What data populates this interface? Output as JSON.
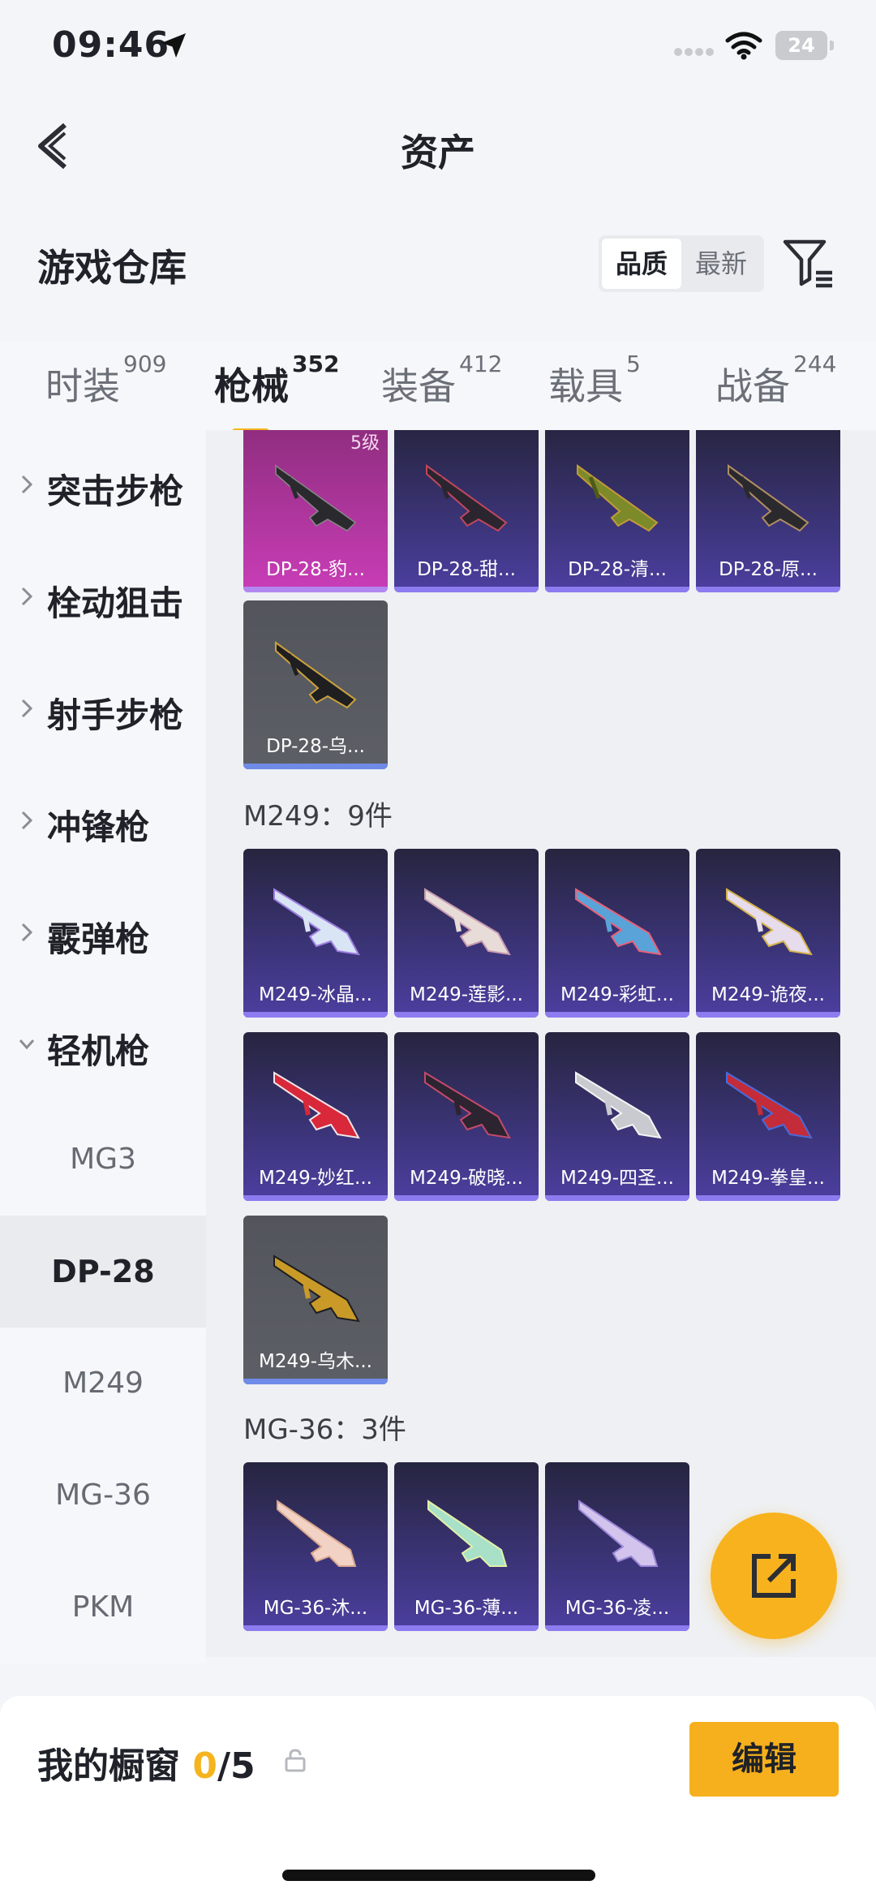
{
  "status": {
    "time": "09:46",
    "battery": "24"
  },
  "nav": {
    "title": "资产"
  },
  "section": {
    "title": "游戏仓库",
    "sort_options": [
      "品质",
      "最新"
    ]
  },
  "tabs": [
    {
      "label": "时装",
      "count": "909"
    },
    {
      "label": "枪械",
      "count": "352"
    },
    {
      "label": "装备",
      "count": "412"
    },
    {
      "label": "载具",
      "count": "5"
    },
    {
      "label": "战备",
      "count": "244"
    }
  ],
  "sidebar": {
    "categories": [
      "突击步枪",
      "栓动狙击",
      "射手步枪",
      "冲锋枪",
      "霰弹枪",
      "轻机枪"
    ],
    "subitems": [
      "MG3",
      "DP-28",
      "M249",
      "MG-36",
      "PKM"
    ]
  },
  "content": {
    "dp28_items": [
      {
        "name": "DP-28-豹...",
        "badge": "5级"
      },
      {
        "name": "DP-28-甜..."
      },
      {
        "name": "DP-28-清..."
      },
      {
        "name": "DP-28-原..."
      },
      {
        "name": "DP-28-乌..."
      }
    ],
    "m249_title": "M249：9件",
    "m249_items": [
      {
        "name": "M249-冰晶..."
      },
      {
        "name": "M249-莲影..."
      },
      {
        "name": "M249-彩虹..."
      },
      {
        "name": "M249-诡夜..."
      },
      {
        "name": "M249-妙红..."
      },
      {
        "name": "M249-破晓..."
      },
      {
        "name": "M249-四圣..."
      },
      {
        "name": "M249-拳皇..."
      },
      {
        "name": "M249-乌木..."
      }
    ],
    "mg36_title": "MG-36：3件",
    "mg36_items": [
      {
        "name": "MG-36-沐..."
      },
      {
        "name": "MG-36-薄..."
      },
      {
        "name": "MG-36-凌..."
      }
    ]
  },
  "bottom": {
    "label": "我的橱窗",
    "current": "0",
    "total": "/5",
    "edit_label": "编辑"
  },
  "colors": {
    "accent": "#f5b41f",
    "card_purple": "#3a3374",
    "card_gray": "#5d5f66",
    "card_pink": "#c93db7"
  },
  "icons": [
    "location-arrow-icon",
    "wifi-icon",
    "back-icon",
    "filter-icon",
    "chevron-right-icon",
    "chevron-down-icon",
    "share-icon",
    "lock-icon"
  ]
}
